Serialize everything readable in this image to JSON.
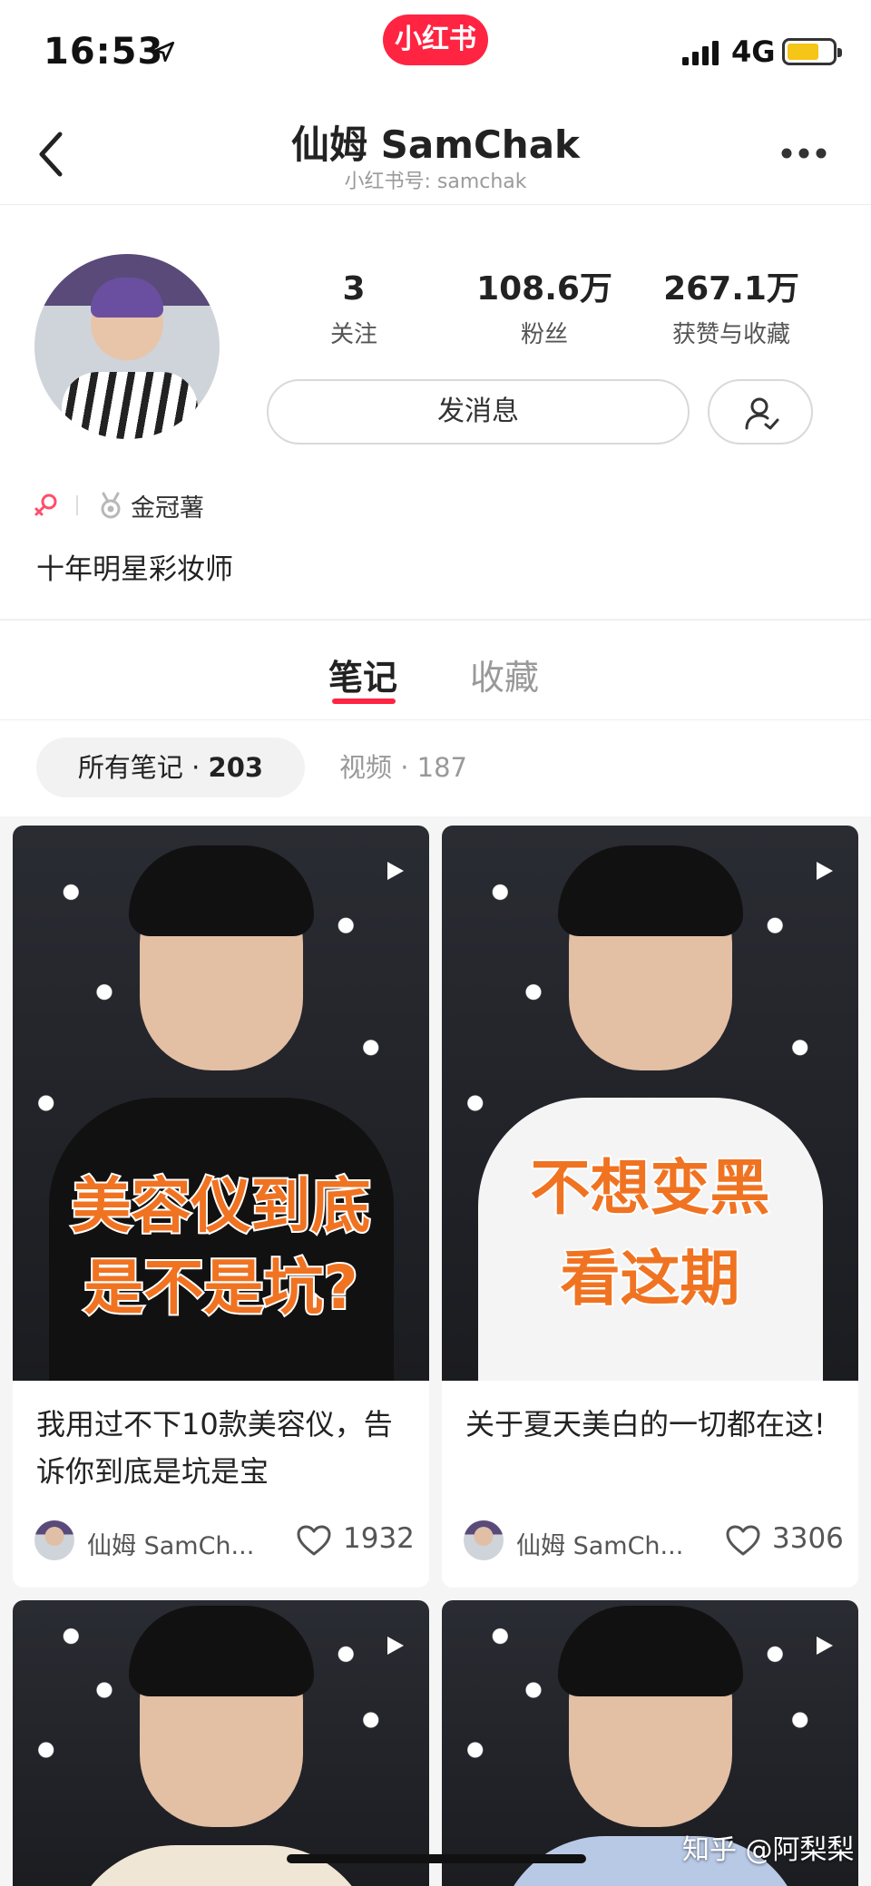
{
  "status_bar": {
    "time": "16:53",
    "app_badge": "小红书",
    "network": "4G",
    "battery_level": 0.7
  },
  "header": {
    "title": "仙姆 SamChak",
    "subtitle": "小红书号: samchak"
  },
  "profile": {
    "stats": [
      {
        "value": "3",
        "label": "关注"
      },
      {
        "value": "108.6万",
        "label": "粉丝"
      },
      {
        "value": "267.1万",
        "label": "获赞与收藏"
      }
    ],
    "message_button": "发消息",
    "badge": "金冠薯",
    "bio": "十年明星彩妆师"
  },
  "tabs": [
    {
      "label": "笔记",
      "active": true
    },
    {
      "label": "收藏",
      "active": false
    }
  ],
  "filters": {
    "all_label": "所有笔记 · ",
    "all_count": "203",
    "video_label": "视频 · 187"
  },
  "notes": [
    {
      "cover_line1": "美容仪到底",
      "cover_line2": "是不是坑?",
      "title": "我用过不下10款美容仪，告诉你到底是坑是宝",
      "author": "仙姆 SamCh...",
      "likes": "1932"
    },
    {
      "cover_line1": "不想变黑",
      "cover_line2": "看这期",
      "title": "关于夏天美白的一切都在这!",
      "author": "仙姆 SamCh...",
      "likes": "3306"
    }
  ],
  "watermark": "知乎 @阿梨梨",
  "colors": {
    "brand_red": "#ff2442",
    "cover_text_orange": "#f07322",
    "battery_yellow": "#f5c518"
  }
}
